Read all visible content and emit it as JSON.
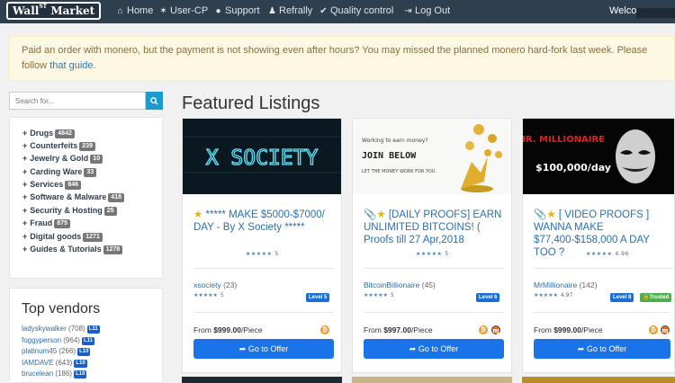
{
  "navbar": {
    "logo_main": "Wall",
    "logo_sup": "ST",
    "logo_tail": " Market",
    "items": [
      {
        "label": "Home",
        "icon": "home-icon",
        "glyph": "⌂"
      },
      {
        "label": "User-CP",
        "icon": "wrench-icon",
        "glyph": "✶"
      },
      {
        "label": "Support",
        "icon": "support-icon",
        "glyph": "●"
      },
      {
        "label": "Refrally",
        "icon": "chess-pawn-icon",
        "glyph": "♟"
      },
      {
        "label": "Quality control",
        "icon": "check-circle-icon",
        "glyph": "✔"
      },
      {
        "label": "Log Out",
        "icon": "logout-icon",
        "glyph": "⇥"
      }
    ],
    "welcome": "Welcome"
  },
  "alert": {
    "text": "Paid an order with monero, but the payment is not showing even after hours? You may missed the planned monero hard-fork last week. Please follow ",
    "link": "that guide",
    "tail": "."
  },
  "search": {
    "placeholder": "Search for...",
    "button_icon": "search-icon"
  },
  "categories": [
    {
      "label": "Drugs",
      "count": "4842"
    },
    {
      "label": "Counterfeits",
      "count": "239"
    },
    {
      "label": "Jewelry & Gold",
      "count": "10"
    },
    {
      "label": "Carding Ware",
      "count": "33"
    },
    {
      "label": "Services",
      "count": "846"
    },
    {
      "label": "Software & Malware",
      "count": "418"
    },
    {
      "label": "Security & Hosting",
      "count": "25"
    },
    {
      "label": "Fraud",
      "count": "875"
    },
    {
      "label": "Digital goods",
      "count": "1271"
    },
    {
      "label": "Guides & Tutorials",
      "count": "1278"
    }
  ],
  "top_vendors": {
    "title": "Top vendors",
    "items": [
      {
        "name": "ladyskywalker",
        "sales": "(708)",
        "level": "L11"
      },
      {
        "name": "foggyperson",
        "sales": "(964)",
        "level": "L11"
      },
      {
        "name": "platinum45",
        "sales": "(266)",
        "level": "L10"
      },
      {
        "name": "IAMDAVE",
        "sales": "(643)",
        "level": "L10"
      },
      {
        "name": "brucelean",
        "sales": "(186)",
        "level": "L10"
      }
    ]
  },
  "featured": {
    "title": "Featured Listings",
    "cards": [
      {
        "image_text": "X SOCIETY",
        "title_prefix": "★ ",
        "title": "***** MAKE $5000-$7000/ DAY - By X Society *****",
        "has_clip": false,
        "rating": "5",
        "vendor": "xsociety",
        "vendor_count": "(23)",
        "vendor_rating": "5",
        "level": "Level 5",
        "trusted": "",
        "price_prefix": "From ",
        "price": "$999.00",
        "price_suffix": "/Piece",
        "coins": [
          "btc"
        ],
        "button": "Go to Offer"
      },
      {
        "image_text_top": "Working to earn money?",
        "image_text_mid": "JOIN BELOW",
        "image_text_bot": "LET THE MONEY WORK FOR YOU.",
        "title_prefix": "★ ",
        "title": "[DAILY PROOFS] EARN UNLIMITED BITCOINS! ( Proofs till 27 Apr,2018",
        "has_clip": true,
        "rating": "5",
        "vendor": "BitcoinBillionaire",
        "vendor_count": "(45)",
        "vendor_rating": "5",
        "level": "Level 6",
        "trusted": "",
        "price_prefix": "From ",
        "price": "$997.00",
        "price_suffix": "/Piece",
        "coins": [
          "btc",
          "xmr"
        ],
        "button": "Go to Offer"
      },
      {
        "image_text_top": "MR. MILLIONAIRE",
        "image_text_bot": "$100,000/day",
        "title_prefix": "★ ",
        "title": "[ VIDEO PROOFS ] WANNA MAKE $77,400-$158,000 A DAY TOO ?",
        "has_clip": true,
        "rating": "4.96",
        "vendor": "MrMillionaire",
        "vendor_count": "(142)",
        "vendor_rating": "4.97",
        "level": "Level 8",
        "trusted": "Trusted",
        "price_prefix": "From ",
        "price": "$999.00",
        "price_suffix": "/Piece",
        "coins": [
          "btc",
          "xmr"
        ],
        "button": "Go to Offer"
      }
    ]
  },
  "colors": {
    "navbar": "#2e3f50",
    "accent": "#1a73e8",
    "alert_bg": "#fcf8e3",
    "btc": "#f09a21",
    "xmr": "#ff6600"
  }
}
